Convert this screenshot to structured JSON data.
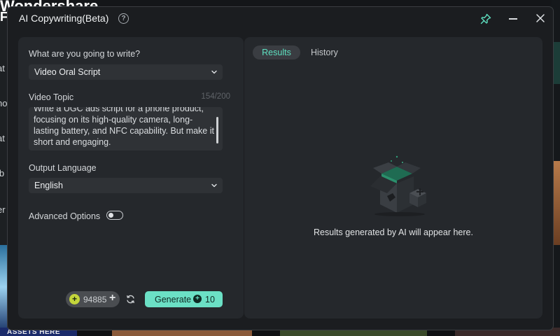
{
  "background": {
    "brand_line1": "Wondershare",
    "brand_line2": "Fil",
    "side_labels": [
      "at",
      "no",
      "at",
      "lb",
      "er"
    ],
    "assets_text": "ASSETS HERE"
  },
  "dialog": {
    "title": "AI Copywriting(Beta)",
    "help_icon": "question-circle-icon",
    "pin_icon": "pin-icon",
    "minimize_icon": "minimize-icon",
    "close_icon": "close-icon"
  },
  "form": {
    "write_label": "What are you going to write?",
    "write_value": "Video Oral Script",
    "topic_label": "Video Topic",
    "topic_counter": "154/200",
    "topic_value": "Write a UGC ads script for a phone product, focusing on its high-quality camera, long-lasting battery, and NFC capability. But make it short and engaging.",
    "language_label": "Output Language",
    "language_value": "English",
    "advanced_label": "Advanced Options",
    "advanced_enabled": false,
    "credits": "94885",
    "generate_label": "Generate",
    "generate_cost": "10"
  },
  "results": {
    "tabs": [
      {
        "label": "Results",
        "active": true
      },
      {
        "label": "History",
        "active": false
      }
    ],
    "empty_message": "Results generated by AI will appear here."
  },
  "colors": {
    "accent": "#6be0c5",
    "panel": "#25282c",
    "dialog": "#1b1d20"
  }
}
